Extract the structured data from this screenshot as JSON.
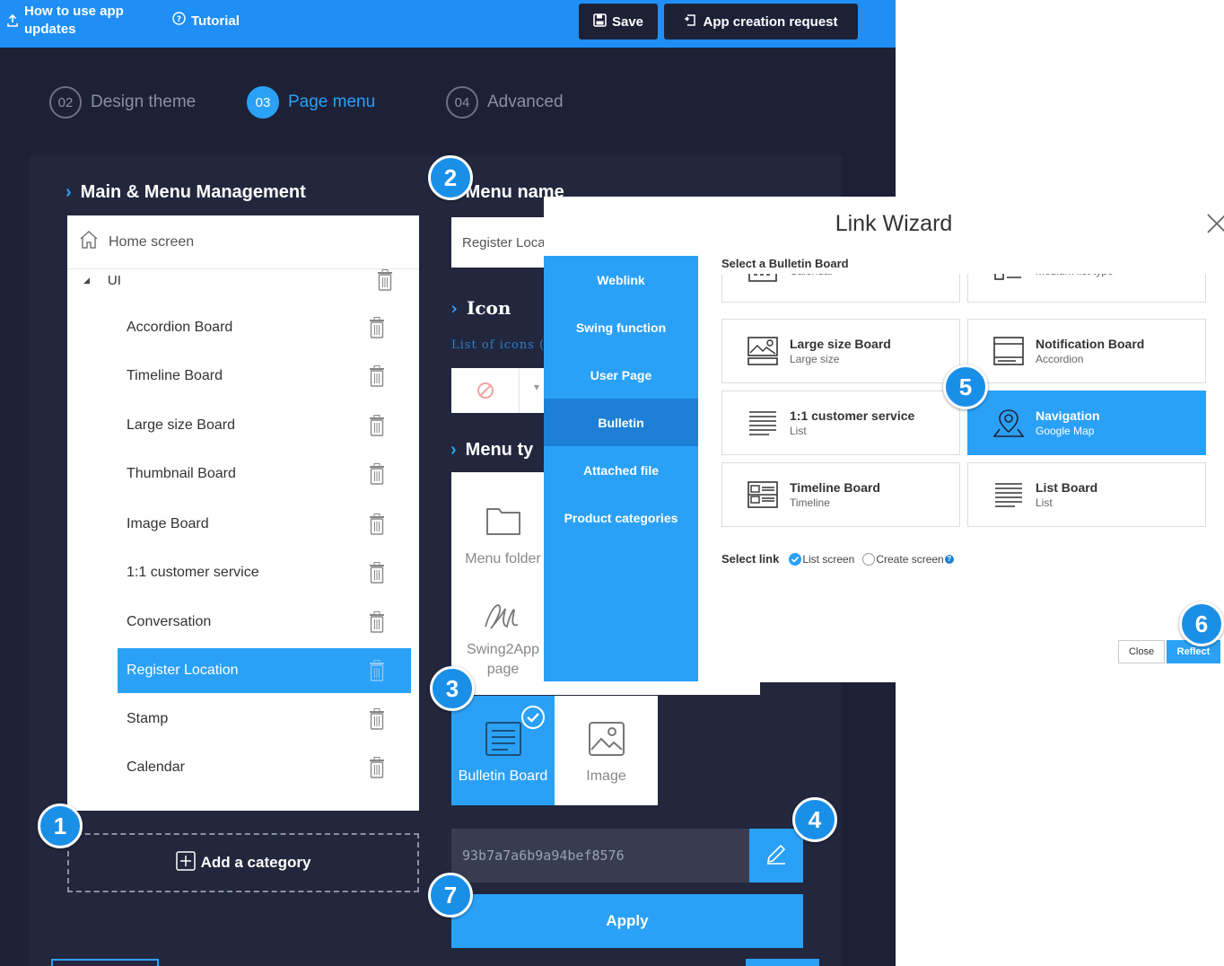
{
  "topbar": {
    "how_to_line1": "How to use app",
    "how_to_line2": "updates",
    "tutorial": "Tutorial",
    "save": "Save",
    "app_creation": "App creation request"
  },
  "steps": [
    {
      "num": "02",
      "label": "Design theme"
    },
    {
      "num": "03",
      "label": "Page menu",
      "active": true
    },
    {
      "num": "04",
      "label": "Advanced"
    }
  ],
  "main_menu": {
    "title": "Main & Menu Management",
    "home": "Home screen",
    "group": "UI",
    "items": [
      "Accordion Board",
      "Timeline Board",
      "Large size Board",
      "Thumbnail Board",
      "Image Board",
      "1:1 customer service",
      "Conversation",
      "Register Location",
      "Stamp",
      "Calendar"
    ],
    "selected": "Register Location",
    "add_category": "Add a category"
  },
  "menu_name": {
    "title": "Menu name",
    "value": "Register Loca"
  },
  "icon": {
    "title": "Icon",
    "list_label": "List of icons ("
  },
  "menu_type": {
    "title": "Menu ty",
    "folder": "Menu folder",
    "swing_line1": "Swing2App",
    "swing_line2": "page",
    "bulletin": "Bulletin Board",
    "image": "Image"
  },
  "hash": "93b7a7a6b9a94bef8576",
  "apply": "Apply",
  "badges": [
    "1",
    "2",
    "3",
    "4",
    "5",
    "6",
    "7"
  ],
  "wizard": {
    "title": "Link Wizard",
    "nav": [
      "Weblink",
      "Swing function",
      "User Page",
      "Bulletin",
      "Attached file",
      "Product categories"
    ],
    "nav_selected": "Bulletin",
    "select_label": "Select a Bulletin Board",
    "boards": [
      {
        "name": "",
        "sub": "Calendar",
        "icon": "calendar-icon"
      },
      {
        "name": "",
        "sub": "Medium list type",
        "icon": "medium-list-icon"
      },
      {
        "name": "Large size Board",
        "sub": "Large size",
        "icon": "large-image-icon"
      },
      {
        "name": "Notification Board",
        "sub": "Accordion",
        "icon": "accordion-icon"
      },
      {
        "name": "1:1 customer service",
        "sub": "List",
        "icon": "list-icon"
      },
      {
        "name": "Navigation",
        "sub": "Google Map",
        "icon": "map-pin-icon",
        "selected": true
      },
      {
        "name": "Timeline Board",
        "sub": "Timeline",
        "icon": "timeline-icon"
      },
      {
        "name": "List Board",
        "sub": "List",
        "icon": "list-icon"
      }
    ],
    "select_link_label": "Select link",
    "option_list": "List screen",
    "option_create": "Create screen",
    "close": "Close",
    "reflect": "Reflect"
  },
  "colors": {
    "accent": "#2aa1f7",
    "dark_bg": "#1d2136",
    "topbar": "#1f8ff5"
  }
}
